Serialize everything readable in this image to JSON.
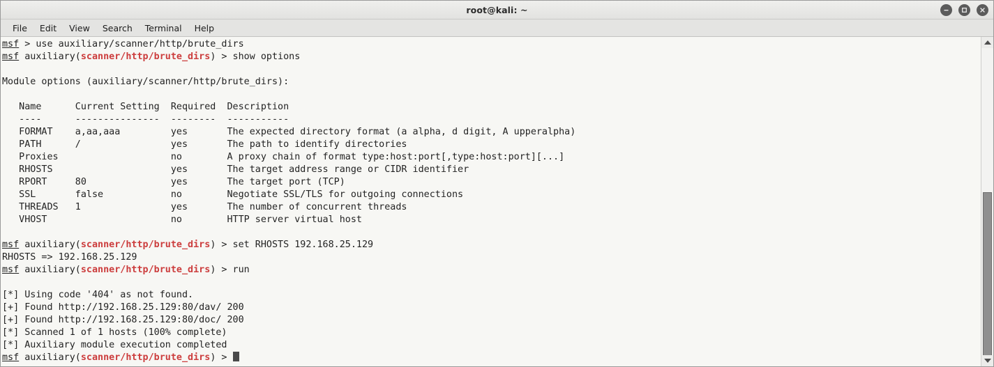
{
  "window": {
    "title": "root@kali: ~",
    "controls": [
      {
        "name": "minimize-button",
        "glyph": "minimize"
      },
      {
        "name": "maximize-button",
        "glyph": "maximize"
      },
      {
        "name": "close-button",
        "glyph": "close"
      }
    ]
  },
  "menubar": {
    "items": [
      "File",
      "Edit",
      "View",
      "Search",
      "Terminal",
      "Help"
    ]
  },
  "colors": {
    "module_red": "#cc3d3d",
    "terminal_bg": "#f7f7f4",
    "terminal_fg": "#232323",
    "titlebar_bg": "#e8e8e6"
  },
  "terminal": {
    "prompt_label": "msf",
    "module_path": "scanner/http/brute_dirs",
    "lines": [
      {
        "type": "prompt",
        "prompt": "msf",
        "module": "",
        "command": " > use auxiliary/scanner/http/brute_dirs"
      },
      {
        "type": "prompt",
        "prompt": "msf",
        "module": "scanner/http/brute_dirs",
        "command": " > show options"
      },
      {
        "type": "blank",
        "text": ""
      },
      {
        "type": "text",
        "text": "Module options (auxiliary/scanner/http/brute_dirs):"
      },
      {
        "type": "blank",
        "text": ""
      },
      {
        "type": "text",
        "text": "   Name      Current Setting  Required  Description"
      },
      {
        "type": "text",
        "text": "   ----      ---------------  --------  -----------"
      },
      {
        "type": "text",
        "text": "   FORMAT    a,aa,aaa         yes       The expected directory format (a alpha, d digit, A upperalpha)"
      },
      {
        "type": "text",
        "text": "   PATH      /                yes       The path to identify directories"
      },
      {
        "type": "text",
        "text": "   Proxies                    no        A proxy chain of format type:host:port[,type:host:port][...]"
      },
      {
        "type": "text",
        "text": "   RHOSTS                     yes       The target address range or CIDR identifier"
      },
      {
        "type": "text",
        "text": "   RPORT     80               yes       The target port (TCP)"
      },
      {
        "type": "text",
        "text": "   SSL       false            no        Negotiate SSL/TLS for outgoing connections"
      },
      {
        "type": "text",
        "text": "   THREADS   1                yes       The number of concurrent threads"
      },
      {
        "type": "text",
        "text": "   VHOST                      no        HTTP server virtual host"
      },
      {
        "type": "blank",
        "text": ""
      },
      {
        "type": "prompt",
        "prompt": "msf",
        "module": "scanner/http/brute_dirs",
        "command": " > set RHOSTS 192.168.25.129"
      },
      {
        "type": "text",
        "text": "RHOSTS => 192.168.25.129"
      },
      {
        "type": "prompt",
        "prompt": "msf",
        "module": "scanner/http/brute_dirs",
        "command": " > run"
      },
      {
        "type": "blank",
        "text": ""
      },
      {
        "type": "text",
        "text": "[*] Using code '404' as not found."
      },
      {
        "type": "text",
        "text": "[+] Found http://192.168.25.129:80/dav/ 200"
      },
      {
        "type": "text",
        "text": "[+] Found http://192.168.25.129:80/doc/ 200"
      },
      {
        "type": "text",
        "text": "[*] Scanned 1 of 1 hosts (100% complete)"
      },
      {
        "type": "text",
        "text": "[*] Auxiliary module execution completed"
      },
      {
        "type": "prompt",
        "prompt": "msf",
        "module": "scanner/http/brute_dirs",
        "command": " > ",
        "cursor": true
      }
    ],
    "options_table": {
      "columns": [
        "Name",
        "Current Setting",
        "Required",
        "Description"
      ],
      "rows": [
        {
          "name": "FORMAT",
          "current": "a,aa,aaa",
          "required": "yes",
          "description": "The expected directory format (a alpha, d digit, A upperalpha)"
        },
        {
          "name": "PATH",
          "current": "/",
          "required": "yes",
          "description": "The path to identify directories"
        },
        {
          "name": "Proxies",
          "current": "",
          "required": "no",
          "description": "A proxy chain of format type:host:port[,type:host:port][...]"
        },
        {
          "name": "RHOSTS",
          "current": "",
          "required": "yes",
          "description": "The target address range or CIDR identifier"
        },
        {
          "name": "RPORT",
          "current": "80",
          "required": "yes",
          "description": "The target port (TCP)"
        },
        {
          "name": "SSL",
          "current": "false",
          "required": "no",
          "description": "Negotiate SSL/TLS for outgoing connections"
        },
        {
          "name": "THREADS",
          "current": "1",
          "required": "yes",
          "description": "The number of concurrent threads"
        },
        {
          "name": "VHOST",
          "current": "",
          "required": "no",
          "description": "HTTP server virtual host"
        }
      ]
    },
    "results": {
      "target_host": "192.168.25.129",
      "found": [
        {
          "url": "http://192.168.25.129:80/dav/",
          "status": "200"
        },
        {
          "url": "http://192.168.25.129:80/doc/",
          "status": "200"
        }
      ],
      "not_found_code": "404",
      "scanned": "1 of 1 hosts",
      "progress": "100% complete",
      "final_status": "Auxiliary module execution completed"
    }
  },
  "scrollbar": {
    "up_arrow": "scroll-up",
    "down_arrow": "scroll-down",
    "thumb_top_pct": 47,
    "thumb_height_pct": 55
  }
}
